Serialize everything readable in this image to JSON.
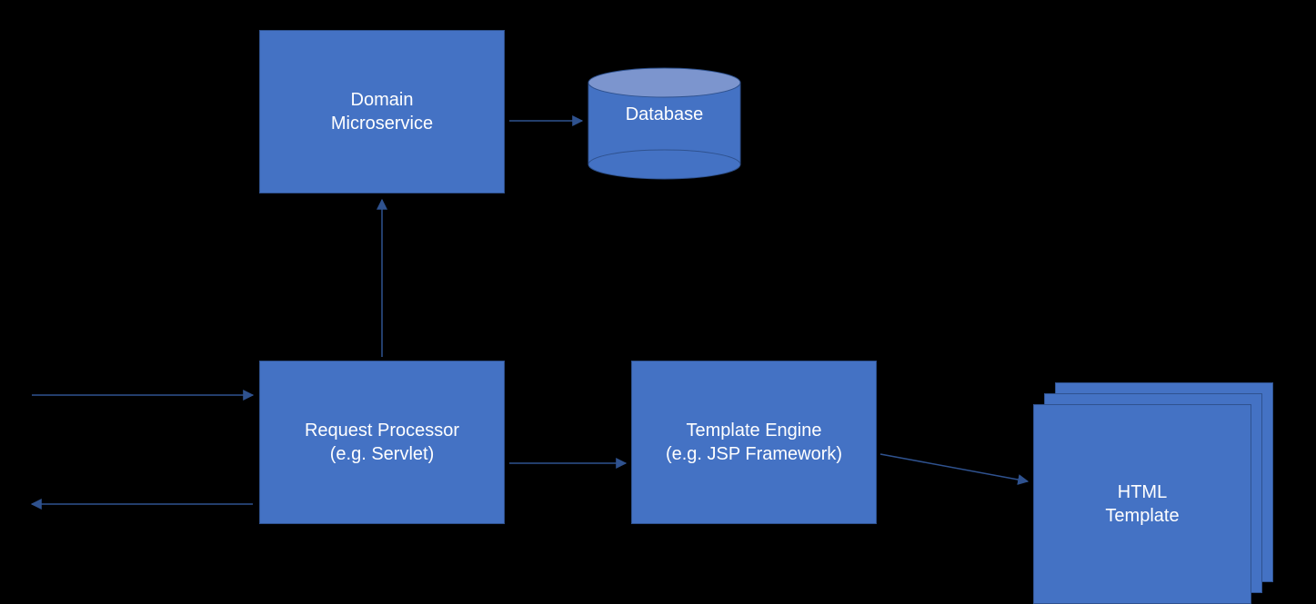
{
  "boxes": {
    "domain_microservice": "Domain\nMicroservice",
    "database": "Database",
    "request_processor": "Request Processor\n(e.g. Servlet)",
    "template_engine": "Template Engine\n(e.g. JSP Framework)",
    "html_template": "HTML\nTemplate"
  },
  "colors": {
    "fill": "#4472C4",
    "stroke": "#2F528F",
    "db_top": "#7C95CE"
  }
}
